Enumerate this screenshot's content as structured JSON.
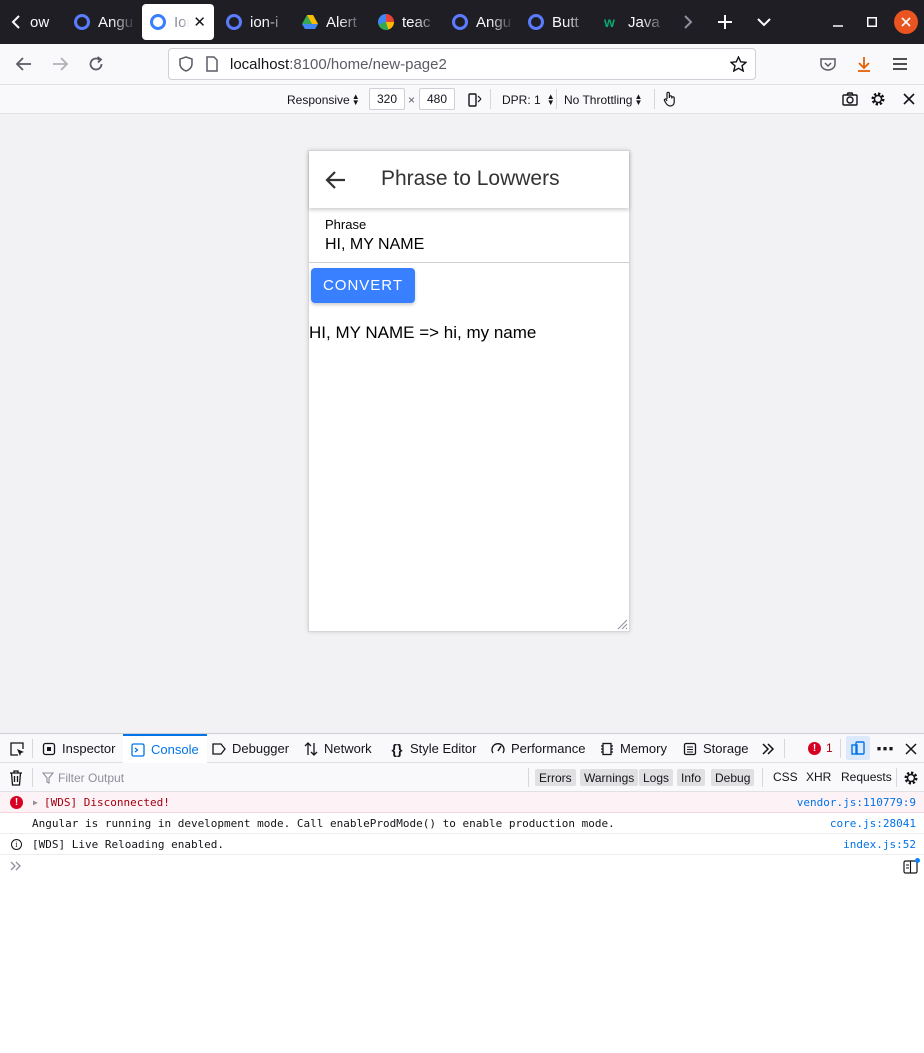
{
  "browser": {
    "tabs": [
      {
        "label": "ow",
        "icon": "ionic-icon"
      },
      {
        "label": "Angu",
        "icon": "ionic-icon"
      },
      {
        "label": "Ion",
        "icon": "ionic-icon",
        "active": true
      },
      {
        "label": "ion-i",
        "icon": "ionic-icon"
      },
      {
        "label": "Alert",
        "icon": "drive-icon"
      },
      {
        "label": "teac",
        "icon": "google-icon"
      },
      {
        "label": "Angu",
        "icon": "ionic-icon"
      },
      {
        "label": "Butt",
        "icon": "ionic-icon"
      },
      {
        "label": "Java",
        "icon": "w3schools-icon"
      }
    ],
    "url_host": "localhost",
    "url_rest": ":8100/home/new-page2"
  },
  "rdm": {
    "device": "Responsive",
    "width": "320",
    "times": "×",
    "height": "480",
    "dpr": "DPR: 1",
    "throttling": "No Throttling"
  },
  "app": {
    "title": "Phrase to Lowwers",
    "field_label": "Phrase",
    "field_value": "HI, MY NAME",
    "button_label": "CONVERT",
    "result": "HI, MY NAME => hi, my name"
  },
  "devtools": {
    "tabs": [
      "Inspector",
      "Console",
      "Debugger",
      "Network",
      "Style Editor",
      "Performance",
      "Memory",
      "Storage"
    ],
    "error_count": "1",
    "filter_placeholder": "Filter Output",
    "levels": [
      "Errors",
      "Warnings",
      "Logs",
      "Info",
      "Debug"
    ],
    "extra_filters": [
      "CSS",
      "XHR",
      "Requests"
    ],
    "messages": [
      {
        "type": "error",
        "text": "[WDS] Disconnected!",
        "location": "vendor.js:110779:9"
      },
      {
        "type": "log",
        "text": "Angular is running in development mode. Call enableProdMode() to enable production mode.",
        "location": "core.js:28041"
      },
      {
        "type": "info",
        "text": "[WDS] Live Reloading enabled.",
        "location": "index.js:52"
      }
    ]
  },
  "colors": {
    "tabbar_bg": "#1f1e25",
    "ionic_primary": "#3880ff",
    "devtools_accent": "#0074e8",
    "error_bg": "#fdf2f5",
    "error_text": "#a4000f",
    "close_orange": "#e95420"
  }
}
